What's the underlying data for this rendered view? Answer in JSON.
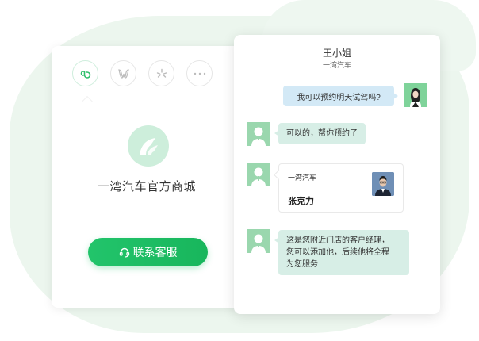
{
  "left_panel": {
    "shop_name": "一湾汽车官方商城",
    "cta_label": "联系客服",
    "tab_icons": [
      "mini-program-icon",
      "brand-icon",
      "sparkle-icon",
      "more-icon"
    ]
  },
  "chat": {
    "title": "王小姐",
    "subtitle": "一湾汽车",
    "messages": [
      {
        "side": "right",
        "text": "我可以预约明天试驾吗?"
      },
      {
        "side": "left",
        "text": "可以的，帮你预约了"
      },
      {
        "side": "left",
        "type": "contact",
        "company": "一湾汽车",
        "name": "张克力"
      },
      {
        "side": "left",
        "lines": [
          "这是您附近门店的客户经理，",
          "您可以添加他，后续他将全程",
          "为您服务"
        ]
      }
    ]
  },
  "colors": {
    "accent": "#22c46b",
    "bubble_customer": "#d3e9f6",
    "bubble_agent": "#d7eee6",
    "background_blob": "#ecf6ee"
  }
}
